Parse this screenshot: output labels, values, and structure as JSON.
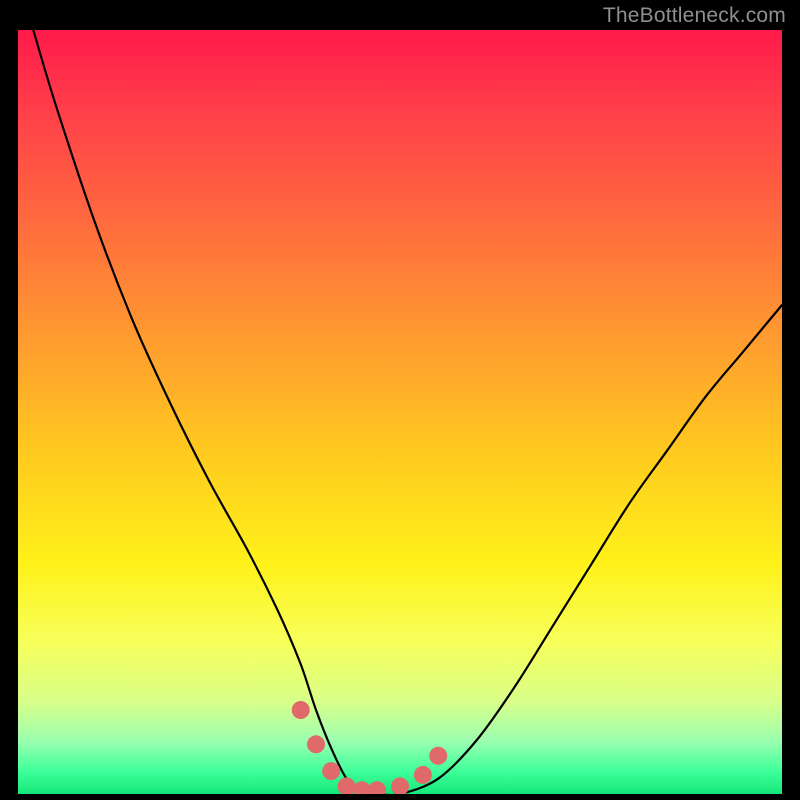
{
  "watermark": {
    "text": "TheBottleneck.com"
  },
  "colors": {
    "curve_stroke": "#000000",
    "marker_fill": "#e06a6a",
    "gradient_top": "#ff1a4a",
    "gradient_bottom": "#14e87a"
  },
  "chart_data": {
    "type": "line",
    "title": "",
    "xlabel": "",
    "ylabel": "",
    "xlim": [
      0,
      100
    ],
    "ylim": [
      0,
      100
    ],
    "grid": false,
    "series": [
      {
        "name": "bottleneck-envelope",
        "x": [
          2,
          5,
          10,
          15,
          20,
          25,
          30,
          34,
          37,
          39,
          41,
          43,
          45,
          47,
          50,
          55,
          60,
          65,
          70,
          75,
          80,
          85,
          90,
          95,
          100
        ],
        "values": [
          100,
          90,
          75,
          62,
          51,
          41,
          32,
          24,
          17,
          11,
          6,
          2,
          0,
          0,
          0,
          2,
          7,
          14,
          22,
          30,
          38,
          45,
          52,
          58,
          64
        ]
      }
    ],
    "markers": {
      "name": "optimal-range-beads",
      "x": [
        37,
        39,
        41,
        43,
        45,
        47,
        50,
        53,
        55
      ],
      "values": [
        11,
        6.5,
        3,
        1,
        0.5,
        0.5,
        1,
        2.5,
        5
      ]
    }
  }
}
